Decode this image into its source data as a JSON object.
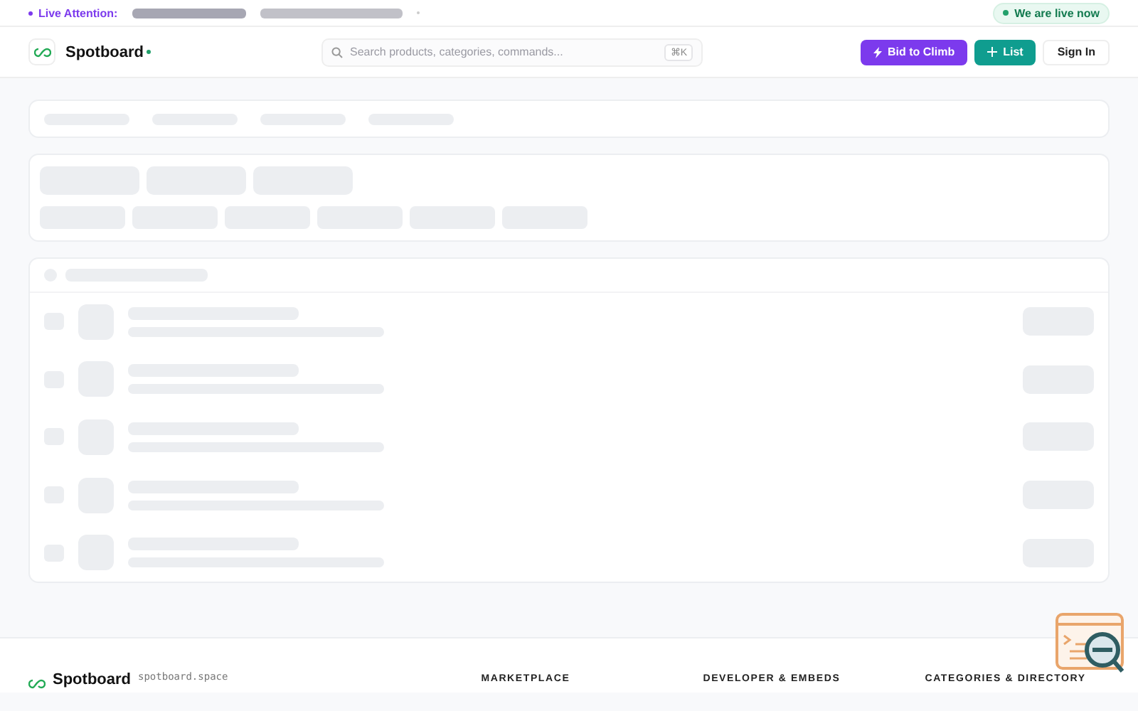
{
  "ticker": {
    "label": "Live Attention:"
  },
  "live_badge": {
    "label": "We are live now"
  },
  "header": {
    "brand": "Spotboard",
    "search": {
      "placeholder": "Search products, categories, commands...",
      "shortcut": "⌘K"
    },
    "buttons": [
      {
        "kind": "bid",
        "label": "Bid to Climb"
      },
      {
        "kind": "list",
        "label": "List"
      },
      {
        "kind": "signin",
        "label": "Sign In"
      }
    ]
  },
  "footer": {
    "brand": "Spotboard",
    "domain": "spotboard.space",
    "columns": [
      "MARKETPLACE",
      "DEVELOPER & EMBEDS",
      "CATEGORIES & DIRECTORY"
    ]
  }
}
